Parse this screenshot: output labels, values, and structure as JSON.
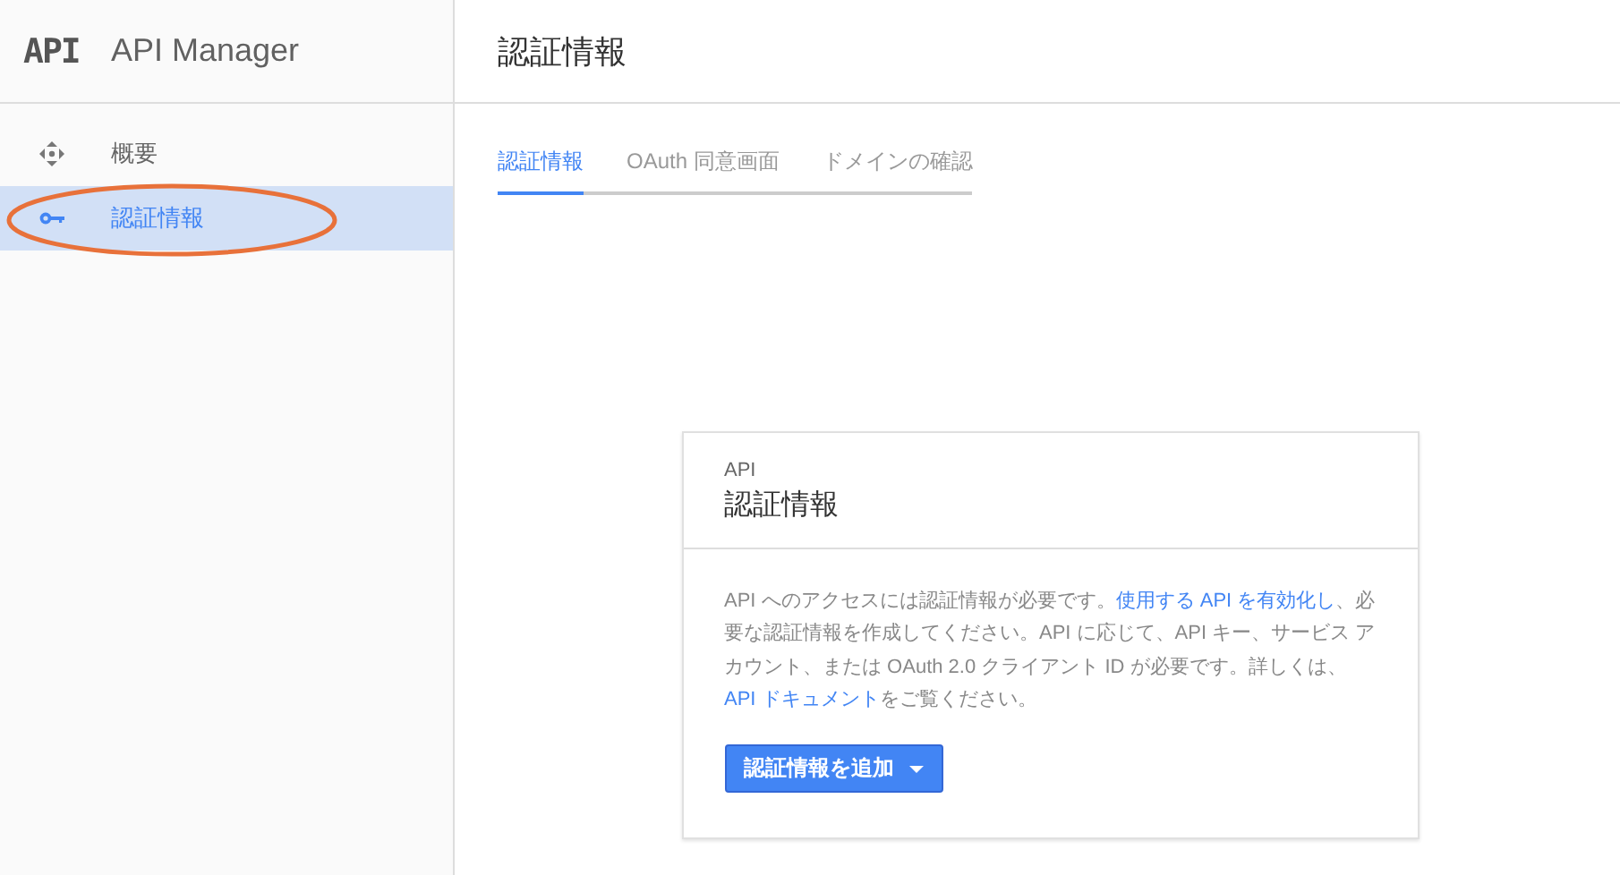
{
  "sidebar": {
    "logo": "API",
    "title": "API Manager",
    "items": [
      {
        "label": "概要",
        "kind": "overview",
        "selected": false
      },
      {
        "label": "認証情報",
        "kind": "credentials",
        "selected": true
      }
    ],
    "annotation": {
      "kind": "ellipse",
      "color": "#e8713a"
    }
  },
  "header": {
    "title": "認証情報"
  },
  "tabs": [
    {
      "label": "認証情報",
      "selected": true
    },
    {
      "label": "OAuth 同意画面",
      "selected": false
    },
    {
      "label": "ドメインの確認",
      "selected": false
    }
  ],
  "card": {
    "subtitle": "API",
    "title": "認証情報",
    "description": [
      {
        "kind": "text",
        "text": "API へのアクセスには認証情報が必要です。"
      },
      {
        "kind": "link",
        "text": "使用する API を有効"
      },
      {
        "kind": "link",
        "text": "化し"
      },
      {
        "kind": "text",
        "text": "、必要な認証情報を作成してください。API に応じて、API キー、サービス アカウント、または OAuth 2.0 クライアント ID が必要です。詳しくは、"
      },
      {
        "kind": "link",
        "text": "API ドキュメント"
      },
      {
        "kind": "text",
        "text": "をご覧ください。"
      }
    ],
    "button": {
      "label": "認証情報を追加"
    }
  }
}
